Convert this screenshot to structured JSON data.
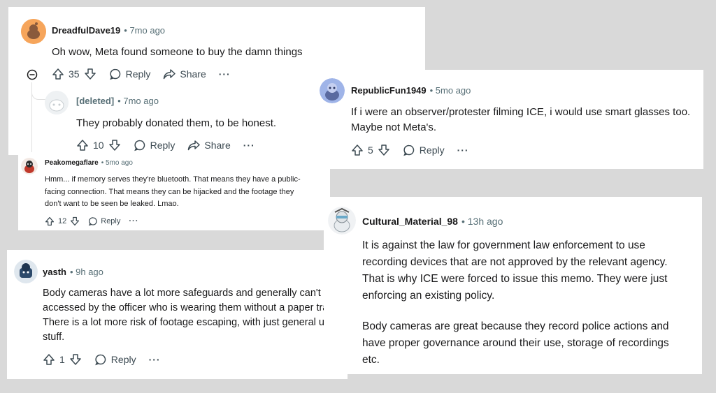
{
  "c1": {
    "username": "DreadfulDave19",
    "time": "• 7mo ago",
    "text": "Oh wow, Meta found someone to buy the damn things",
    "votes": "35",
    "reply": "Reply",
    "share": "Share",
    "more": "···",
    "child": {
      "username": "[deleted]",
      "time": "• 7mo ago",
      "text": "They probably donated them, to be honest.",
      "votes": "10",
      "reply": "Reply",
      "share": "Share",
      "more": "···"
    }
  },
  "c2": {
    "username": "RepublicFun1949",
    "time": "• 5mo ago",
    "text_lines": [
      "If i were an observer/protester filming ICE, i would use smart glasses too.",
      "Maybe not Meta's."
    ],
    "votes": "5",
    "reply": "Reply",
    "more": "···"
  },
  "c3": {
    "username": "Peakomegaflare",
    "time": "• 5mo ago",
    "text_lines": [
      "Hmm... if memory serves they're bluetooth. That means they have a public-",
      "facing connection. That means they can be hijacked and the footage they",
      "don't want to be seen be leaked. Lmao."
    ],
    "votes": "12",
    "reply": "Reply",
    "more": "···"
  },
  "c4": {
    "username": "yasth",
    "time": "• 9h ago",
    "text_lines": [
      "Body cameras have a lot more safeguards and generally can't be",
      "accessed by the officer who is wearing them without a paper trail.",
      "There is a lot more risk of footage escaping, with just general use",
      "stuff."
    ],
    "votes": "1",
    "reply": "Reply",
    "more": "···"
  },
  "c5": {
    "username": "Cultural_Material_98",
    "time": "• 13h ago",
    "para1_lines": [
      "It is against the law for government law enforcement to use",
      "recording devices that are not approved by the relevant agency.",
      "That is why ICE were forced to issue this memo. They were just",
      "enforcing an existing policy."
    ],
    "para2_lines": [
      "Body cameras are great because they record police actions and",
      "have proper governance around their use, storage of recordings",
      "etc."
    ]
  },
  "colors": {
    "meta_gray": "#576f76",
    "upvote": "#3c4a52",
    "background": "#d9d9d9"
  }
}
